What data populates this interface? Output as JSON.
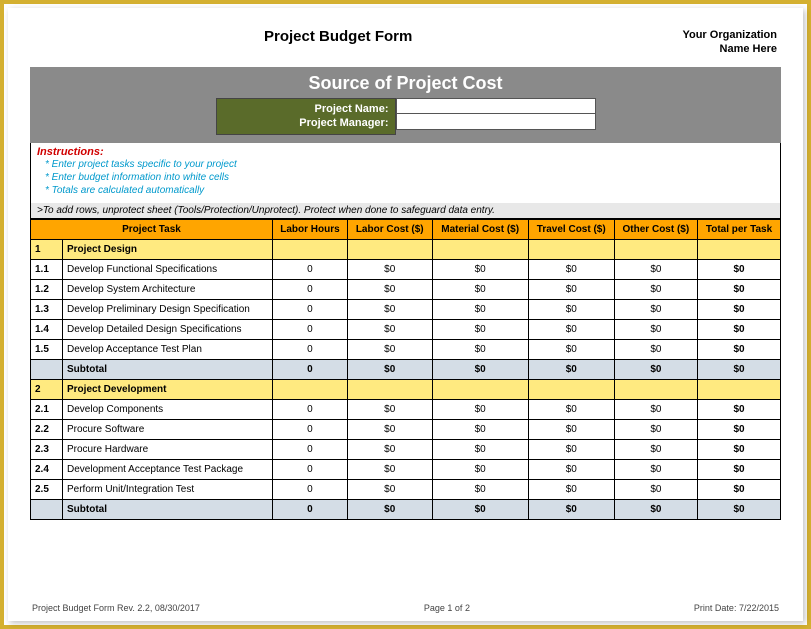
{
  "header": {
    "title": "Project Budget Form",
    "org_line1": "Your Organization",
    "org_line2": "Name Here"
  },
  "banner": {
    "title": "Source of Project Cost",
    "label_name": "Project Name:",
    "label_manager": "Project Manager:",
    "value_name": "",
    "value_manager": ""
  },
  "instructions": {
    "head": "Instructions:",
    "items": [
      "* Enter project tasks specific to your project",
      "* Enter budget information into white cells",
      "* Totals are calculated automatically"
    ],
    "unprotect": ">To add rows, unprotect sheet (Tools/Protection/Unprotect).  Protect when done to safeguard data entry."
  },
  "columns": {
    "task": "Project Task",
    "hours": "Labor Hours",
    "labor": "Labor Cost ($)",
    "material": "Material Cost ($)",
    "travel": "Travel Cost ($)",
    "other": "Other Cost ($)",
    "total": "Total per Task"
  },
  "sections": [
    {
      "num": "1",
      "name": "Project Design",
      "rows": [
        {
          "num": "1.1",
          "task": "Develop Functional Specifications",
          "hours": "0",
          "labor": "$0",
          "material": "$0",
          "travel": "$0",
          "other": "$0",
          "total": "$0"
        },
        {
          "num": "1.2",
          "task": "Develop System Architecture",
          "hours": "0",
          "labor": "$0",
          "material": "$0",
          "travel": "$0",
          "other": "$0",
          "total": "$0"
        },
        {
          "num": "1.3",
          "task": "Develop Preliminary Design Specification",
          "hours": "0",
          "labor": "$0",
          "material": "$0",
          "travel": "$0",
          "other": "$0",
          "total": "$0"
        },
        {
          "num": "1.4",
          "task": "Develop Detailed Design Specifications",
          "hours": "0",
          "labor": "$0",
          "material": "$0",
          "travel": "$0",
          "other": "$0",
          "total": "$0"
        },
        {
          "num": "1.5",
          "task": "Develop Acceptance Test Plan",
          "hours": "0",
          "labor": "$0",
          "material": "$0",
          "travel": "$0",
          "other": "$0",
          "total": "$0"
        }
      ],
      "subtotal": {
        "label": "Subtotal",
        "hours": "0",
        "labor": "$0",
        "material": "$0",
        "travel": "$0",
        "other": "$0",
        "total": "$0"
      }
    },
    {
      "num": "2",
      "name": "Project Development",
      "rows": [
        {
          "num": "2.1",
          "task": "Develop Components",
          "hours": "0",
          "labor": "$0",
          "material": "$0",
          "travel": "$0",
          "other": "$0",
          "total": "$0"
        },
        {
          "num": "2.2",
          "task": "Procure Software",
          "hours": "0",
          "labor": "$0",
          "material": "$0",
          "travel": "$0",
          "other": "$0",
          "total": "$0"
        },
        {
          "num": "2.3",
          "task": "Procure Hardware",
          "hours": "0",
          "labor": "$0",
          "material": "$0",
          "travel": "$0",
          "other": "$0",
          "total": "$0"
        },
        {
          "num": "2.4",
          "task": "Development Acceptance Test Package",
          "hours": "0",
          "labor": "$0",
          "material": "$0",
          "travel": "$0",
          "other": "$0",
          "total": "$0"
        },
        {
          "num": "2.5",
          "task": "Perform Unit/Integration Test",
          "hours": "0",
          "labor": "$0",
          "material": "$0",
          "travel": "$0",
          "other": "$0",
          "total": "$0"
        }
      ],
      "subtotal": {
        "label": "Subtotal",
        "hours": "0",
        "labor": "$0",
        "material": "$0",
        "travel": "$0",
        "other": "$0",
        "total": "$0"
      }
    }
  ],
  "footer": {
    "rev": "Project Budget Form Rev. 2.2, 08/30/2017",
    "page": "Page 1 of 2",
    "printdate": "Print Date: 7/22/2015"
  }
}
